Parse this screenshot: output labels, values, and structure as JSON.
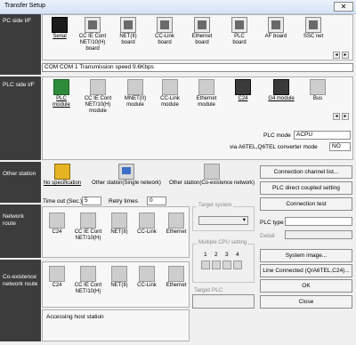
{
  "window": {
    "title": "Transfer Setup",
    "close_glyph": "✕"
  },
  "sections": {
    "pc_side": "PC side I/F",
    "plc_side": "PLC side I/F",
    "other_station": "Other station",
    "network_route": "Network route",
    "coexistence": "Co-existence network route"
  },
  "pc_side": {
    "items": [
      {
        "label": "Serial",
        "icon": "serial-icon",
        "selected": true
      },
      {
        "label": "CC IE Cont NET/10(H) board",
        "icon": "board-icon"
      },
      {
        "label": "NET(II) board",
        "icon": "board-icon"
      },
      {
        "label": "CC-Link board",
        "icon": "board-icon"
      },
      {
        "label": "Ethernet board",
        "icon": "board-icon"
      },
      {
        "label": "PLC board",
        "icon": "board-icon"
      },
      {
        "label": "AF board",
        "icon": "board-icon"
      },
      {
        "label": "SSC net",
        "icon": "board-icon"
      }
    ],
    "com_info": "COM  COM 1   Transmission speed  9.6Kbps"
  },
  "plc_side": {
    "items": [
      {
        "label": "PLC module",
        "icon": "plc-module-icon",
        "selected": true
      },
      {
        "label": "CC IE Cont NET/10(H) module",
        "icon": "module-icon"
      },
      {
        "label": "MNET(II) module",
        "icon": "module-icon"
      },
      {
        "label": "CC-Link module",
        "icon": "module-icon"
      },
      {
        "label": "Ethernet module",
        "icon": "module-icon"
      },
      {
        "label": "C24",
        "icon": "c24-icon"
      },
      {
        "label": "G4 module",
        "icon": "g4-module-icon"
      },
      {
        "label": "Bus",
        "icon": "bus-icon"
      }
    ],
    "plc_mode_label": "PLC mode",
    "plc_mode_value": "ACPU",
    "via_label": "via A6TEL,Q6TEL converter mode",
    "via_value": "NO"
  },
  "other_station": {
    "items": [
      {
        "label": "No specification",
        "selected": true
      },
      {
        "label": "Other station(Single network)"
      },
      {
        "label": "Other station(Co-existence network)"
      }
    ],
    "timeout_label": "Time out (Sec.)",
    "timeout_value": "5",
    "retry_label": "Retry times",
    "retry_value": "0"
  },
  "network_route": {
    "items": [
      "C24",
      "CC IE Cont NET/10(H)",
      "NET(II)",
      "CC-Link",
      "Ethernet"
    ]
  },
  "coexistence": {
    "items": [
      "C24",
      "CC IE Cont NET/10(H)",
      "NET(II)",
      "CC-Link",
      "Ethernet"
    ]
  },
  "target_system": {
    "title": "Target system"
  },
  "multiple_cpu": {
    "title": "Multiple CPU setting",
    "slots": [
      "1",
      "2",
      "3",
      "4"
    ]
  },
  "target_plc": {
    "label": "Target PLC"
  },
  "plc_type": {
    "label": "PLC type",
    "detail_label": "Detail"
  },
  "status": {
    "text": "Accessing host station"
  },
  "buttons": {
    "connection_channel": "Connection channel list...",
    "plc_direct": "PLC direct coupled setting",
    "connection_test": "Connection test",
    "system_image": "System image...",
    "line_connected": "Line Connected (Q/A6TEL,C24)...",
    "ok": "OK",
    "close": "Close"
  },
  "colors": {
    "sidebar": "#3c3c3c",
    "selected_icon": "#1c1c1c"
  }
}
